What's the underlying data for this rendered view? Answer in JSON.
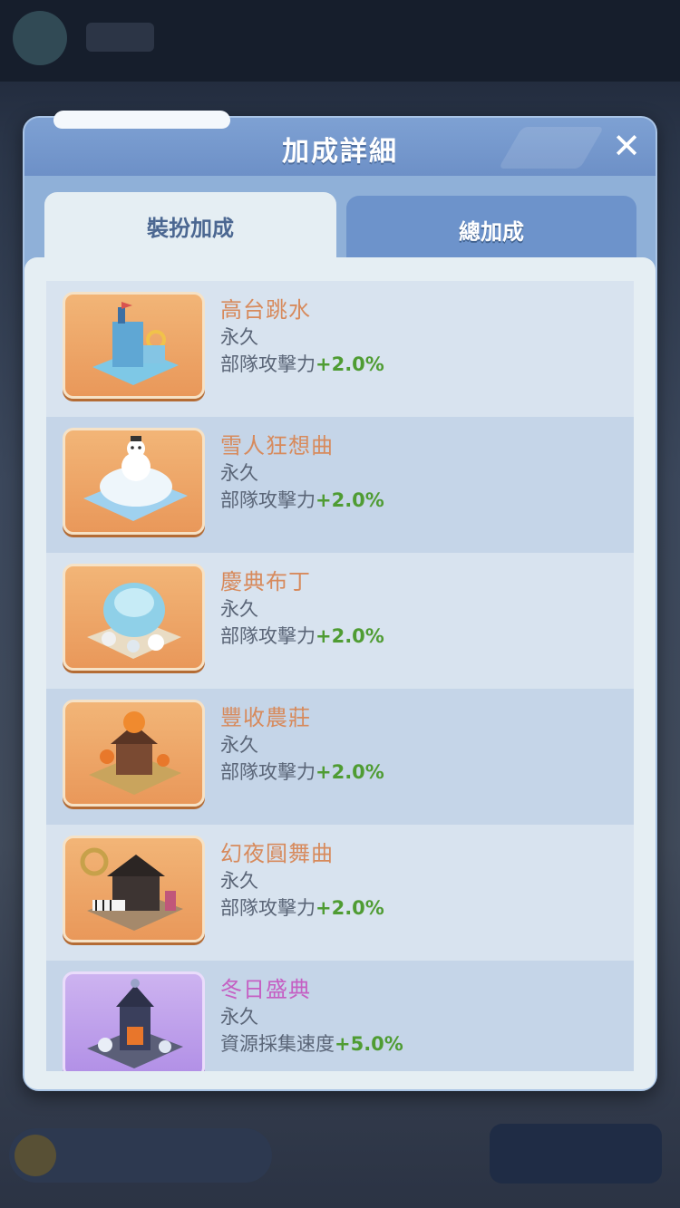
{
  "dialog": {
    "title": "加成詳細",
    "close_icon": "close-icon",
    "tabs": [
      {
        "label": "裝扮加成",
        "active": true
      },
      {
        "label": "總加成",
        "active": false
      }
    ]
  },
  "items": [
    {
      "name": "高台跳水",
      "duration": "永久",
      "effect": "部隊攻擊力",
      "value": "+2.0%",
      "thumb": "diving-platform-icon",
      "rarity": "orange"
    },
    {
      "name": "雪人狂想曲",
      "duration": "永久",
      "effect": "部隊攻擊力",
      "value": "+2.0%",
      "thumb": "snowman-icon",
      "rarity": "orange"
    },
    {
      "name": "慶典布丁",
      "duration": "永久",
      "effect": "部隊攻擊力",
      "value": "+2.0%",
      "thumb": "pudding-icon",
      "rarity": "orange"
    },
    {
      "name": "豐收農莊",
      "duration": "永久",
      "effect": "部隊攻擊力",
      "value": "+2.0%",
      "thumb": "harvest-farm-icon",
      "rarity": "orange"
    },
    {
      "name": "幻夜圓舞曲",
      "duration": "永久",
      "effect": "部隊攻擊力",
      "value": "+2.0%",
      "thumb": "night-waltz-icon",
      "rarity": "orange"
    },
    {
      "name": "冬日盛典",
      "duration": "永久",
      "effect": "資源採集速度",
      "value": "+5.0%",
      "thumb": "winter-festival-icon",
      "rarity": "purple"
    }
  ],
  "colors": {
    "name_orange": "#d78a5c",
    "name_purple": "#c55fc3",
    "value_green": "#4f9c33",
    "header_blue": "#6d90c7"
  }
}
